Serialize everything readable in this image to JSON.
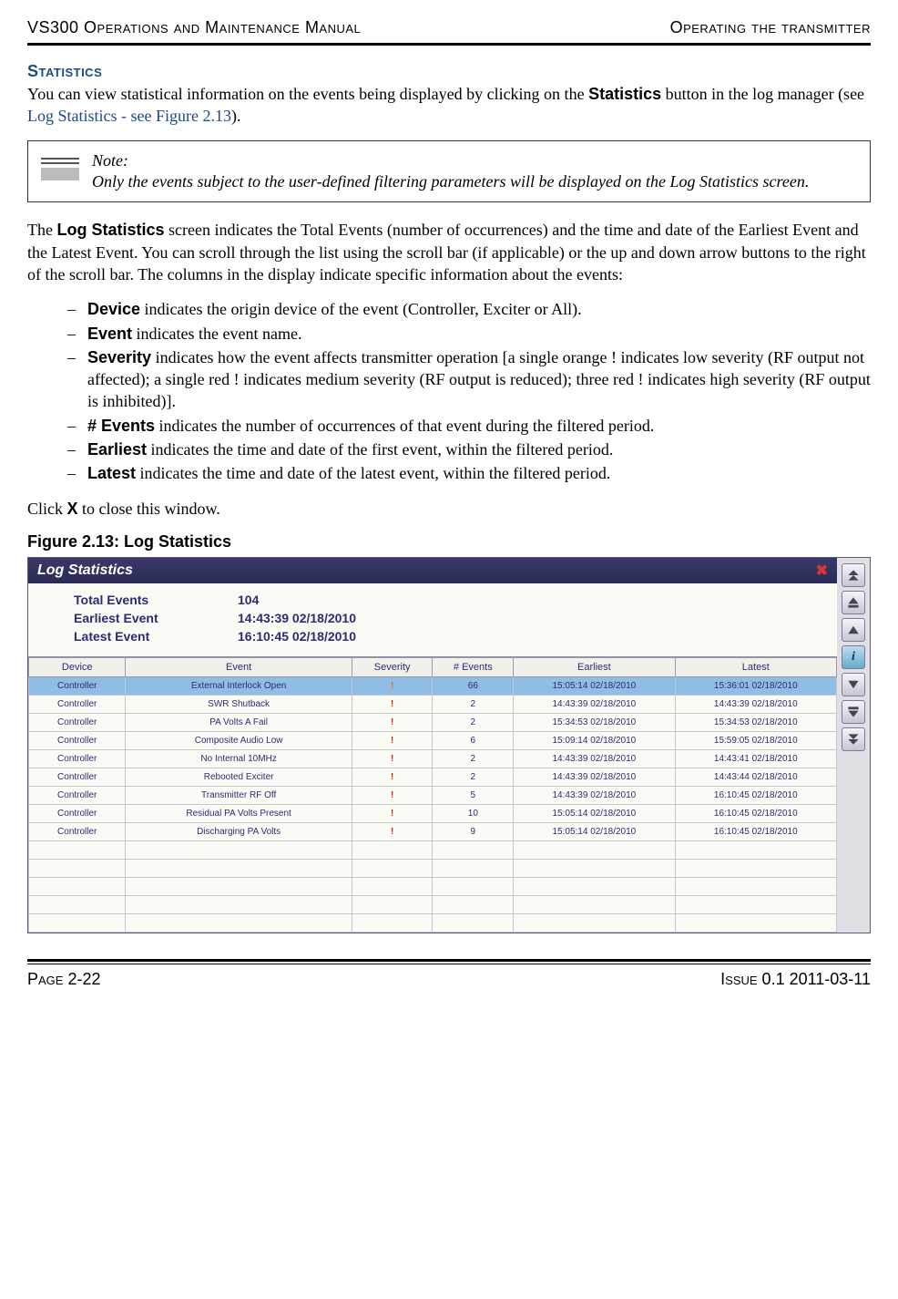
{
  "header": {
    "left": "VS300 Operations and Maintenance Manual",
    "right": "Operating the transmitter"
  },
  "footer": {
    "left": "Page 2-22",
    "right": "Issue 0.1  2011-03-11"
  },
  "section_title": "Statistics",
  "intro_a": "You can view statistical information on the events being displayed by clicking on the ",
  "intro_btn": "Statistics",
  "intro_b": " button in the log manager (see ",
  "intro_link": "Log Statistics - see Figure 2.13",
  "intro_c": ").",
  "note_label": "Note:",
  "note_body": "Only the events subject to the user-defined filtering parameters will be displayed on the Log Statistics screen.",
  "para2_a": "The ",
  "para2_b": "Log Statistics",
  "para2_c": " screen indicates the Total Events (number of occurrences) and the time and date of the Earliest Event and the Latest Event. You can scroll through the list using the scroll bar (if applicable) or the up and down arrow buttons to the right of the scroll bar. The columns in the display indicate specific information about the events:",
  "defs": [
    {
      "term": "Device",
      "text": " indicates the origin device of the event (Controller, Exciter or All)."
    },
    {
      "term": "Event",
      "text": " indicates the event name."
    },
    {
      "term": "Severity",
      "text": " indicates how the event affects transmitter operation [a single orange ! indicates low severity (RF output not affected); a single red ! indicates medium severity (RF output is reduced); three red ! indicates high severity (RF output is inhibited)]."
    },
    {
      "term": "# Events",
      "text": " indicates the number of occurrences of that event during the filtered period."
    },
    {
      "term": "Earliest",
      "text": " indicates the time and date of the first event, within the filtered period."
    },
    {
      "term": "Latest",
      "text": " indicates the time and date of the latest event, within the filtered period."
    }
  ],
  "close_a": "Click ",
  "close_b": "X",
  "close_c": " to close this window.",
  "fig_caption": "Figure 2.13: Log Statistics",
  "logstats": {
    "title": "Log Statistics",
    "close": "✖",
    "summary": [
      {
        "label": "Total Events",
        "value": "104"
      },
      {
        "label": "Earliest Event",
        "value": "14:43:39 02/18/2010"
      },
      {
        "label": "Latest Event",
        "value": "16:10:45 02/18/2010"
      }
    ],
    "cols": [
      "Device",
      "Event",
      "Severity",
      "# Events",
      "Earliest",
      "Latest"
    ],
    "rows": [
      {
        "sel": true,
        "device": "Controller",
        "event": "External Interlock Open",
        "sev": "!",
        "sevc": "orange",
        "n": "66",
        "e": "15:05:14 02/18/2010",
        "l": "15:36:01 02/18/2010"
      },
      {
        "sel": false,
        "device": "Controller",
        "event": "SWR Shutback",
        "sev": "!",
        "sevc": "red",
        "n": "2",
        "e": "14:43:39 02/18/2010",
        "l": "14:43:39 02/18/2010"
      },
      {
        "sel": false,
        "device": "Controller",
        "event": "PA Volts A Fail",
        "sev": "!",
        "sevc": "red",
        "n": "2",
        "e": "15:34:53 02/18/2010",
        "l": "15:34:53 02/18/2010"
      },
      {
        "sel": false,
        "device": "Controller",
        "event": "Composite Audio Low",
        "sev": "!",
        "sevc": "red",
        "n": "6",
        "e": "15:09:14 02/18/2010",
        "l": "15:59:05 02/18/2010"
      },
      {
        "sel": false,
        "device": "Controller",
        "event": "No Internal 10MHz",
        "sev": "!",
        "sevc": "red",
        "n": "2",
        "e": "14:43:39 02/18/2010",
        "l": "14:43:41 02/18/2010"
      },
      {
        "sel": false,
        "device": "Controller",
        "event": "Rebooted Exciter",
        "sev": "!",
        "sevc": "red",
        "n": "2",
        "e": "14:43:39 02/18/2010",
        "l": "14:43:44 02/18/2010"
      },
      {
        "sel": false,
        "device": "Controller",
        "event": "Transmitter RF Off",
        "sev": "!",
        "sevc": "red",
        "n": "5",
        "e": "14:43:39 02/18/2010",
        "l": "16:10:45 02/18/2010"
      },
      {
        "sel": false,
        "device": "Controller",
        "event": "Residual PA Volts Present",
        "sev": "!",
        "sevc": "red",
        "n": "10",
        "e": "15:05:14 02/18/2010",
        "l": "16:10:45 02/18/2010"
      },
      {
        "sel": false,
        "device": "Controller",
        "event": "Discharging PA Volts",
        "sev": "!",
        "sevc": "red",
        "n": "9",
        "e": "15:05:14 02/18/2010",
        "l": "16:10:45 02/18/2010"
      }
    ],
    "blank_rows": 5
  }
}
